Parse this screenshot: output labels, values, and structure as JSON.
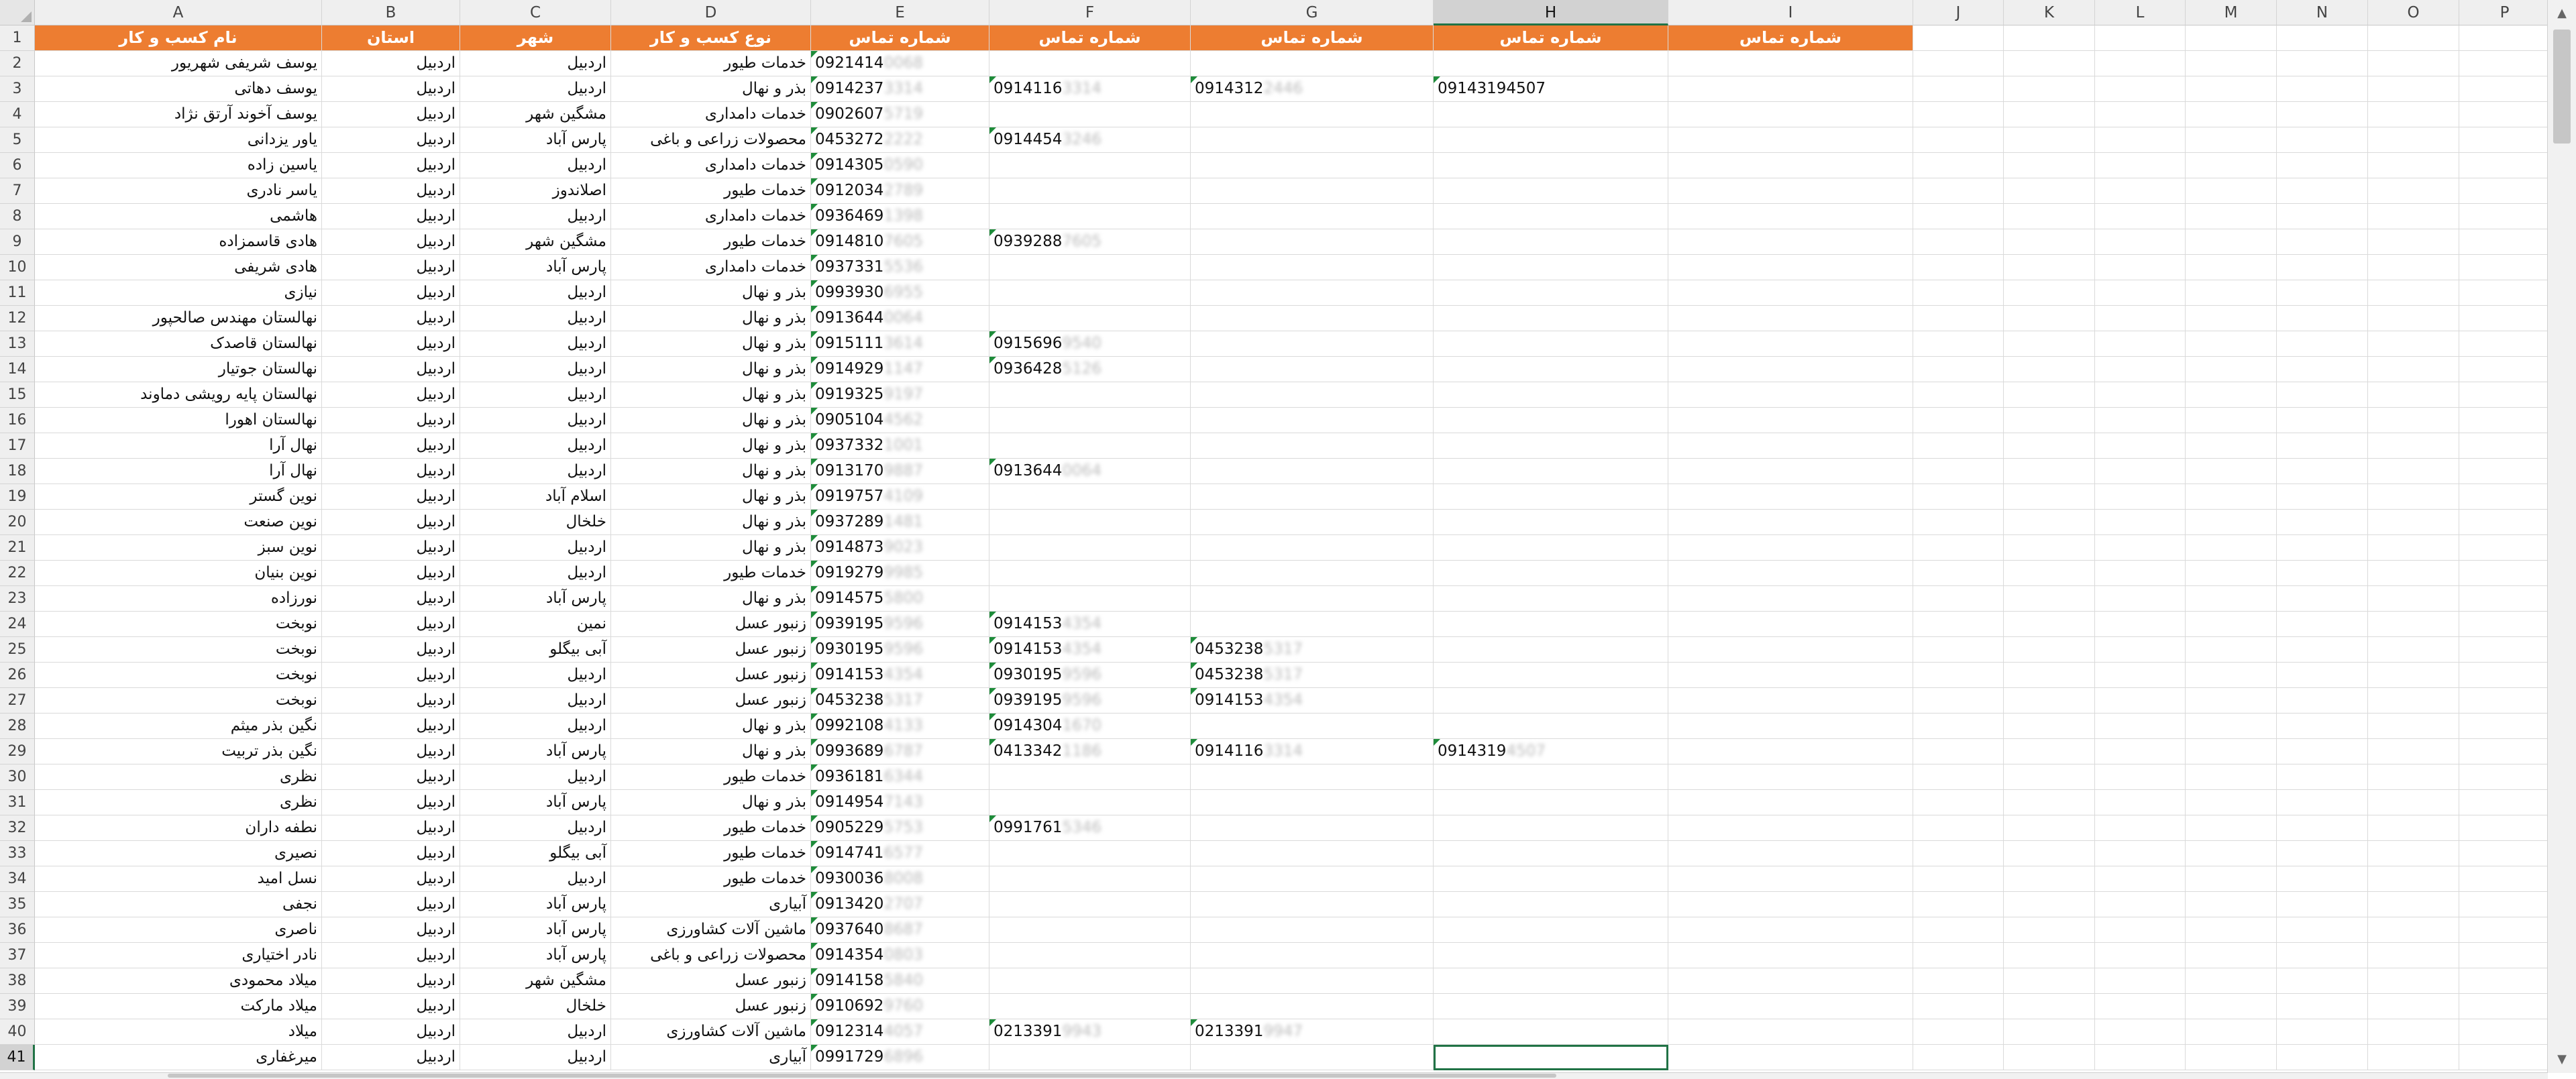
{
  "columns": [
    "A",
    "B",
    "C",
    "D",
    "E",
    "F",
    "G",
    "H",
    "I",
    "J",
    "K",
    "L",
    "M",
    "N",
    "O",
    "P"
  ],
  "headers": [
    "نام کسب و کار",
    "استان",
    "شهر",
    "نوع کسب و کار",
    "شماره تماس",
    "شماره تماس",
    "شماره تماس",
    "شماره تماس",
    "شماره تماس"
  ],
  "rows": [
    {
      "n": "2",
      "a": "یوسف شریفی شهریور",
      "b": "اردبیل",
      "c": "اردبیل",
      "d": "خدمات طیور",
      "e": [
        "0921414",
        "0068"
      ],
      "f": null,
      "g": null,
      "h": null
    },
    {
      "n": "3",
      "a": "یوسف دهاتی",
      "b": "اردبیل",
      "c": "اردبیل",
      "d": "بذر و نهال",
      "e": [
        "0914237",
        "3314"
      ],
      "f": [
        "0914116",
        "3314"
      ],
      "g": [
        "0914312",
        "2446"
      ],
      "h": [
        "09143194507",
        ""
      ]
    },
    {
      "n": "4",
      "a": "یوسف آخوند آرتق نژاد",
      "b": "اردبیل",
      "c": "مشگین شهر",
      "d": "خدمات دامداری",
      "e": [
        "0902607",
        "5719"
      ],
      "f": null,
      "g": null,
      "h": null
    },
    {
      "n": "5",
      "a": "یاور یزدانی",
      "b": "اردبیل",
      "c": "پارس آباد",
      "d": "محصولات زراعی و باغی",
      "e": [
        "0453272",
        "2222"
      ],
      "f": [
        "0914454",
        "3246"
      ],
      "g": null,
      "h": null
    },
    {
      "n": "6",
      "a": "یاسین زاده",
      "b": "اردبیل",
      "c": "اردبیل",
      "d": "خدمات دامداری",
      "e": [
        "0914305",
        "0590"
      ],
      "f": null,
      "g": null,
      "h": null
    },
    {
      "n": "7",
      "a": "یاسر نادری",
      "b": "اردبیل",
      "c": "اصلاندوز",
      "d": "خدمات طیور",
      "e": [
        "0912034",
        "2789"
      ],
      "f": null,
      "g": null,
      "h": null
    },
    {
      "n": "8",
      "a": "هاشمی",
      "b": "اردبیل",
      "c": "اردبیل",
      "d": "خدمات دامداری",
      "e": [
        "0936469",
        "1398"
      ],
      "f": null,
      "g": null,
      "h": null
    },
    {
      "n": "9",
      "a": "هادی قاسمزاده",
      "b": "اردبیل",
      "c": "مشگین شهر",
      "d": "خدمات طیور",
      "e": [
        "0914810",
        "7605"
      ],
      "f": [
        "0939288",
        "7605"
      ],
      "g": null,
      "h": null
    },
    {
      "n": "10",
      "a": "هادی شریفی",
      "b": "اردبیل",
      "c": "پارس آباد",
      "d": "خدمات دامداری",
      "e": [
        "0937331",
        "5536"
      ],
      "f": null,
      "g": null,
      "h": null
    },
    {
      "n": "11",
      "a": "نیازی",
      "b": "اردبیل",
      "c": "اردبیل",
      "d": "بذر و نهال",
      "e": [
        "0993930",
        "6955"
      ],
      "f": null,
      "g": null,
      "h": null
    },
    {
      "n": "12",
      "a": "نهالستان مهندس صالحپور",
      "b": "اردبیل",
      "c": "اردبیل",
      "d": "بذر و نهال",
      "e": [
        "0913644",
        "0064"
      ],
      "f": null,
      "g": null,
      "h": null
    },
    {
      "n": "13",
      "a": "نهالستان قاصدک",
      "b": "اردبیل",
      "c": "اردبیل",
      "d": "بذر و نهال",
      "e": [
        "0915111",
        "3614"
      ],
      "f": [
        "0915696",
        "9540"
      ],
      "g": null,
      "h": null
    },
    {
      "n": "14",
      "a": "نهالستان جوتیار",
      "b": "اردبیل",
      "c": "اردبیل",
      "d": "بذر و نهال",
      "e": [
        "0914929",
        "1147"
      ],
      "f": [
        "0936428",
        "5126"
      ],
      "g": null,
      "h": null
    },
    {
      "n": "15",
      "a": "نهالستان پایه رویشی دماوند",
      "b": "اردبیل",
      "c": "اردبیل",
      "d": "بذر و نهال",
      "e": [
        "0919325",
        "9197"
      ],
      "f": null,
      "g": null,
      "h": null
    },
    {
      "n": "16",
      "a": "نهالستان اهورا",
      "b": "اردبیل",
      "c": "اردبیل",
      "d": "بذر و نهال",
      "e": [
        "0905104",
        "4562"
      ],
      "f": null,
      "g": null,
      "h": null
    },
    {
      "n": "17",
      "a": "نهال آرا",
      "b": "اردبیل",
      "c": "اردبیل",
      "d": "بذر و نهال",
      "e": [
        "0937332",
        "1001"
      ],
      "f": null,
      "g": null,
      "h": null
    },
    {
      "n": "18",
      "a": "نهال آرا",
      "b": "اردبیل",
      "c": "اردبیل",
      "d": "بذر و نهال",
      "e": [
        "0913170",
        "9887"
      ],
      "f": [
        "0913644",
        "0064"
      ],
      "g": null,
      "h": null
    },
    {
      "n": "19",
      "a": "نوین گستر",
      "b": "اردبیل",
      "c": "اسلام آباد",
      "d": "بذر و نهال",
      "e": [
        "0919757",
        "4109"
      ],
      "f": null,
      "g": null,
      "h": null
    },
    {
      "n": "20",
      "a": "نوین صنعت",
      "b": "اردبیل",
      "c": "خلخال",
      "d": "بذر و نهال",
      "e": [
        "0937289",
        "1481"
      ],
      "f": null,
      "g": null,
      "h": null
    },
    {
      "n": "21",
      "a": "نوین سبز",
      "b": "اردبیل",
      "c": "اردبیل",
      "d": "بذر و نهال",
      "e": [
        "0914873",
        "9023"
      ],
      "f": null,
      "g": null,
      "h": null
    },
    {
      "n": "22",
      "a": "نوین بنیان",
      "b": "اردبیل",
      "c": "اردبیل",
      "d": "خدمات طیور",
      "e": [
        "0919279",
        "9985"
      ],
      "f": null,
      "g": null,
      "h": null
    },
    {
      "n": "23",
      "a": "نورزاده",
      "b": "اردبیل",
      "c": "پارس آباد",
      "d": "بذر و نهال",
      "e": [
        "0914575",
        "5800"
      ],
      "f": null,
      "g": null,
      "h": null
    },
    {
      "n": "24",
      "a": "نوبخت",
      "b": "اردبیل",
      "c": "نمین",
      "d": "زنبور عسل",
      "e": [
        "0939195",
        "9596"
      ],
      "f": [
        "0914153",
        "4354"
      ],
      "g": null,
      "h": null
    },
    {
      "n": "25",
      "a": "نوبخت",
      "b": "اردبیل",
      "c": "آبی بیگلو",
      "d": "زنبور عسل",
      "e": [
        "0930195",
        "9596"
      ],
      "f": [
        "0914153",
        "4354"
      ],
      "g": [
        "0453238",
        "5317"
      ],
      "h": null
    },
    {
      "n": "26",
      "a": "نوبخت",
      "b": "اردبیل",
      "c": "اردبیل",
      "d": "زنبور عسل",
      "e": [
        "0914153",
        "4354"
      ],
      "f": [
        "0930195",
        "9596"
      ],
      "g": [
        "0453238",
        "5317"
      ],
      "h": null
    },
    {
      "n": "27",
      "a": "نوبخت",
      "b": "اردبیل",
      "c": "اردبیل",
      "d": "زنبور عسل",
      "e": [
        "0453238",
        "5317"
      ],
      "f": [
        "0939195",
        "9596"
      ],
      "g": [
        "0914153",
        "4354"
      ],
      "h": null
    },
    {
      "n": "28",
      "a": "نگین بذر میثم",
      "b": "اردبیل",
      "c": "اردبیل",
      "d": "بذر و نهال",
      "e": [
        "0992108",
        "4133"
      ],
      "f": [
        "0914304",
        "1670"
      ],
      "g": null,
      "h": null
    },
    {
      "n": "29",
      "a": "نگین بذر تربیت",
      "b": "اردبیل",
      "c": "پارس آباد",
      "d": "بذر و نهال",
      "e": [
        "0993689",
        "6787"
      ],
      "f": [
        "0413342",
        "1186"
      ],
      "g": [
        "0914116",
        "3314"
      ],
      "h": [
        "0914319",
        "4507"
      ]
    },
    {
      "n": "30",
      "a": "نظری",
      "b": "اردبیل",
      "c": "اردبیل",
      "d": "خدمات طیور",
      "e": [
        "0936181",
        "6344"
      ],
      "f": null,
      "g": null,
      "h": null
    },
    {
      "n": "31",
      "a": "نظری",
      "b": "اردبیل",
      "c": "پارس آباد",
      "d": "بذر و نهال",
      "e": [
        "0914954",
        "7143"
      ],
      "f": null,
      "g": null,
      "h": null
    },
    {
      "n": "32",
      "a": "نطفه داران",
      "b": "اردبیل",
      "c": "اردبیل",
      "d": "خدمات طیور",
      "e": [
        "0905229",
        "5753"
      ],
      "f": [
        "0991761",
        "5346"
      ],
      "g": null,
      "h": null
    },
    {
      "n": "33",
      "a": "نصیری",
      "b": "اردبیل",
      "c": "آبی بیگلو",
      "d": "خدمات طیور",
      "e": [
        "0914741",
        "6577"
      ],
      "f": null,
      "g": null,
      "h": null
    },
    {
      "n": "34",
      "a": "نسل امید",
      "b": "اردبیل",
      "c": "اردبیل",
      "d": "خدمات طیور",
      "e": [
        "0930036",
        "8008"
      ],
      "f": null,
      "g": null,
      "h": null
    },
    {
      "n": "35",
      "a": "نجفی",
      "b": "اردبیل",
      "c": "پارس آباد",
      "d": "آبیاری",
      "e": [
        "0913420",
        "2707"
      ],
      "f": null,
      "g": null,
      "h": null
    },
    {
      "n": "36",
      "a": "ناصری",
      "b": "اردبیل",
      "c": "پارس آباد",
      "d": "ماشین آلات کشاورزی",
      "e": [
        "0937640",
        "8687"
      ],
      "f": null,
      "g": null,
      "h": null
    },
    {
      "n": "37",
      "a": "نادر اختیاری",
      "b": "اردبیل",
      "c": "پارس آباد",
      "d": "محصولات زراعی و باغی",
      "e": [
        "0914354",
        "0803"
      ],
      "f": null,
      "g": null,
      "h": null
    },
    {
      "n": "38",
      "a": "میلاد محمودی",
      "b": "اردبیل",
      "c": "مشگین شهر",
      "d": "زنبور عسل",
      "e": [
        "0914158",
        "5840"
      ],
      "f": null,
      "g": null,
      "h": null
    },
    {
      "n": "39",
      "a": "میلاد مارکت",
      "b": "اردبیل",
      "c": "خلخال",
      "d": "زنبور عسل",
      "e": [
        "0910692",
        "9760"
      ],
      "f": null,
      "g": null,
      "h": null
    },
    {
      "n": "40",
      "a": "میلاد",
      "b": "اردبیل",
      "c": "اردبیل",
      "d": "ماشین آلات کشاورزی",
      "e": [
        "0912314",
        "4057"
      ],
      "f": [
        "0213391",
        "9943"
      ],
      "g": [
        "0213391",
        "9947"
      ],
      "h": null
    },
    {
      "n": "41",
      "a": "میرغفاری",
      "b": "اردبیل",
      "c": "اردبیل",
      "d": "آبیاری",
      "e": [
        "0991729",
        "6896"
      ],
      "f": null,
      "g": null,
      "h": null
    }
  ],
  "selection": {
    "column": "H",
    "row": "41"
  },
  "colors": {
    "header_fill": "#ed7d31",
    "selection": "#217346",
    "error_triangle": "#1e8c3a"
  }
}
